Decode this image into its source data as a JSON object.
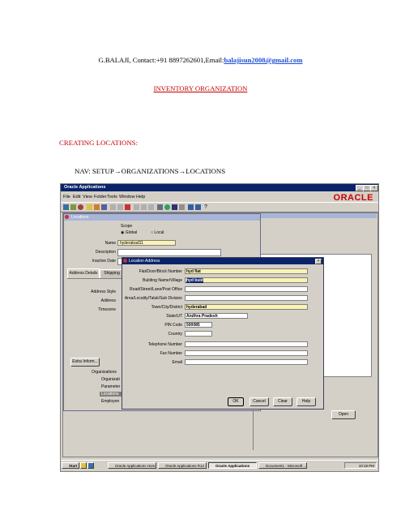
{
  "doc": {
    "header_prefix": "G.BALAJI, Contact:+91 8897262601,Email:",
    "email": "balajisun2008@gmail.com",
    "title": "INVENTORY ORGANIZATION",
    "section": "CREATING LOCATIONS:",
    "nav_prefix": "NAV: SETUP",
    "nav_mid": "ORGANIZATIONS",
    "nav_end": "LOCATIONS",
    "arrow": "→"
  },
  "app": {
    "window_title": "Oracle Applications",
    "logo": "ORACLE",
    "menu": [
      "File",
      "Edit",
      "View",
      "Folder",
      "Tools",
      "Window",
      "Help"
    ]
  },
  "locations_form": {
    "title": "Locations",
    "scope_label": "Scope",
    "scope_global": "Global",
    "scope_local": "Local",
    "name_label": "Name",
    "name_value": "hyderabad11",
    "description_label": "Description",
    "inactive_label": "Inactive Date",
    "tab_address": "Address Details",
    "tab_shipping": "Shipping",
    "address_style_label": "Address Style",
    "address_label": "Address",
    "timezone_label": "Timezone",
    "extra_button": "Extra Inform...",
    "tree": [
      "Organizations",
      "Organizati",
      "Parameter",
      "Locations",
      "Employee"
    ],
    "open_button": "Open"
  },
  "address_dialog": {
    "title": "Location Address",
    "fields": [
      {
        "label": "Flat/Door/Block Number",
        "value": "hyd flat",
        "highlight": true
      },
      {
        "label": "Building Name/Village",
        "value": "hyd buid",
        "highlight": true
      },
      {
        "label": "Road/Street/Lane/Post Office",
        "value": "",
        "highlight": false
      },
      {
        "label": "Area/Locality/Taluk/Sub Division",
        "value": "",
        "highlight": false
      },
      {
        "label": "Town/City/District",
        "value": "hyderabad",
        "highlight": true
      },
      {
        "label": "State/UT",
        "value": "Andhra Pradesh",
        "highlight": false
      },
      {
        "label": "PIN Code",
        "value": "500085",
        "highlight": false
      },
      {
        "label": "Country",
        "value": "",
        "highlight": false
      },
      {
        "label": "Telephone Number",
        "value": "",
        "highlight": false
      },
      {
        "label": "Fax Number",
        "value": "",
        "highlight": false
      },
      {
        "label": "Email",
        "value": "",
        "highlight": false
      }
    ],
    "ok": "OK",
    "cancel": "Cancel",
    "clear": "Clear",
    "help": "Help"
  },
  "taskbar": {
    "start": "Start",
    "tasks": [
      "Oracle Applications Hom...",
      "Oracle Applications R12 -...",
      "Oracle Applications",
      "Document1 - Microsoft ..."
    ],
    "clock": "10:18 PM"
  }
}
